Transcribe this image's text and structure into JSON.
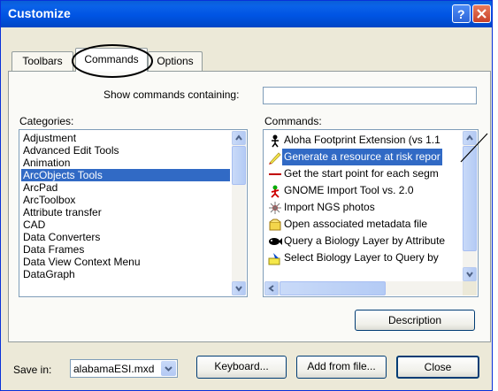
{
  "window": {
    "title": "Customize"
  },
  "tabs": [
    {
      "label": "Toolbars"
    },
    {
      "label": "Commands"
    },
    {
      "label": "Options"
    }
  ],
  "search": {
    "label": "Show commands containing:",
    "value": ""
  },
  "categories": {
    "label": "Categories:",
    "items": [
      {
        "label": "Adjustment"
      },
      {
        "label": "Advanced Edit Tools"
      },
      {
        "label": "Animation"
      },
      {
        "label": "ArcObjects Tools"
      },
      {
        "label": "ArcPad"
      },
      {
        "label": "ArcToolbox"
      },
      {
        "label": "Attribute transfer"
      },
      {
        "label": "CAD"
      },
      {
        "label": "Data Converters"
      },
      {
        "label": "Data Frames"
      },
      {
        "label": "Data View Context Menu"
      },
      {
        "label": "DataGraph"
      }
    ],
    "selected": "ArcObjects Tools"
  },
  "commands": {
    "label": "Commands:",
    "items": [
      {
        "label": "Aloha Footprint Extension (vs 1.1",
        "icon": "aloha-icon"
      },
      {
        "label": "Generate a resource at risk repor",
        "icon": "pencil-icon"
      },
      {
        "label": "Get the start point for each segm",
        "icon": "line-icon"
      },
      {
        "label": "GNOME Import Tool vs. 2.0",
        "icon": "gnome-icon"
      },
      {
        "label": "Import NGS photos",
        "icon": "photos-icon"
      },
      {
        "label": "Open associated metadata file",
        "icon": "metadata-icon"
      },
      {
        "label": "Query a Biology Layer by Attribute",
        "icon": "fish-icon"
      },
      {
        "label": "Select Biology Layer to Query by",
        "icon": "select-icon"
      }
    ],
    "selected": "Generate a resource at risk repor"
  },
  "buttons": {
    "description": "Description",
    "keyboard": "Keyboard...",
    "add_from_file": "Add from file...",
    "close": "Close"
  },
  "save_in": {
    "label": "Save in:",
    "value": "alabamaESI.mxd"
  },
  "colors": {
    "titlebar": "#0054e3",
    "selection": "#316ac5",
    "dialog": "#ece9d8"
  }
}
